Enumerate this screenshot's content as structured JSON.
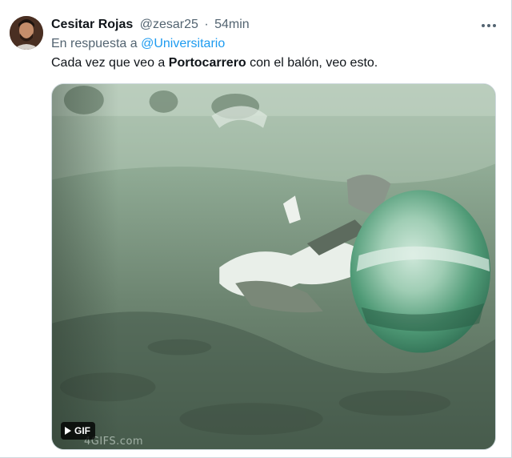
{
  "tweet": {
    "author": {
      "display_name": "Cesitar Rojas",
      "handle": "@zesar25",
      "separator": "·",
      "time": "54min"
    },
    "reply": {
      "prefix": "En respuesta a",
      "mention": "@Universitario"
    },
    "text": {
      "before": "Cada vez que veo a ",
      "bold": "Portocarrero",
      "after": " con el balón, veo esto."
    },
    "media": {
      "badge_label": "GIF",
      "watermark": "4GIFS.com"
    },
    "more_icon": "more-horizontal-icon"
  },
  "colors": {
    "text_primary": "#0f1419",
    "text_secondary": "#536471",
    "link": "#1d9bf0"
  }
}
